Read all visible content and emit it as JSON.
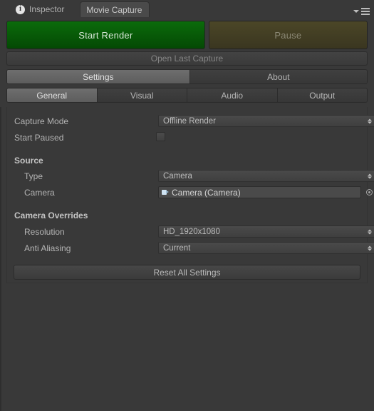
{
  "window": {
    "tabs": [
      {
        "label": "Inspector",
        "icon": "info-icon",
        "active": false
      },
      {
        "label": "Movie Capture",
        "active": true
      }
    ],
    "menu_icon": "hamburger-menu-icon",
    "dropdown_icon": "chevron-down-icon"
  },
  "actions": {
    "start_render": "Start Render",
    "pause": "Pause",
    "open_last_capture": "Open Last Capture",
    "start_render_color": "#0b6b0b",
    "pause_color": "#4b4627"
  },
  "primary_tabs": [
    {
      "label": "Settings",
      "selected": true
    },
    {
      "label": "About",
      "selected": false
    }
  ],
  "secondary_tabs": [
    {
      "label": "General",
      "selected": true
    },
    {
      "label": "Visual",
      "selected": false
    },
    {
      "label": "Audio",
      "selected": false
    },
    {
      "label": "Output",
      "selected": false
    }
  ],
  "fields": {
    "capture_mode": {
      "label": "Capture Mode",
      "value": "Offline Render"
    },
    "start_paused": {
      "label": "Start Paused",
      "checked": false
    },
    "source_header": "Source",
    "source_type": {
      "label": "Type",
      "value": "Camera"
    },
    "source_camera": {
      "label": "Camera",
      "value": "Camera (Camera)",
      "icon": "camera-icon",
      "picker_icon": "object-picker-icon"
    },
    "overrides_header": "Camera Overrides",
    "resolution": {
      "label": "Resolution",
      "value": "HD_1920x1080"
    },
    "anti_aliasing": {
      "label": "Anti Aliasing",
      "value": "Current"
    }
  },
  "reset_button": "Reset All Settings"
}
